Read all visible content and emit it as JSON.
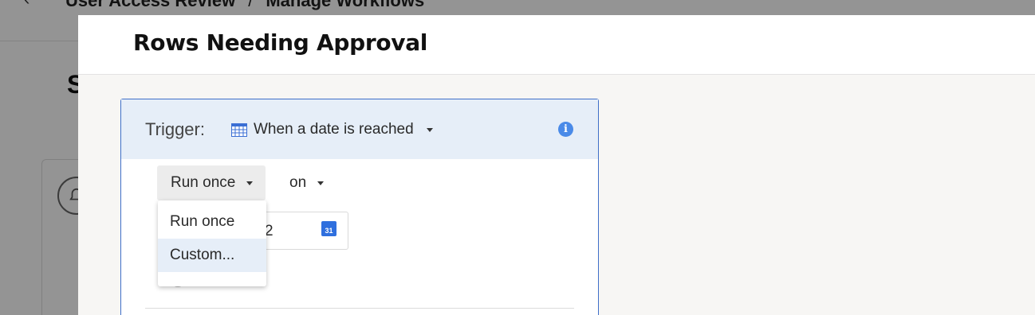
{
  "background": {
    "breadcrumb": [
      "User Access Review",
      "Manage Workflows"
    ],
    "breadcrumb_separator": "/",
    "side_title": "S"
  },
  "modal": {
    "title": "Rows Needing Approval"
  },
  "trigger": {
    "label": "Trigger:",
    "selected": "When a date is reached",
    "calendar_icon": "calendar-grid-icon",
    "info_icon": "info-icon",
    "info_glyph": "i"
  },
  "schedule": {
    "frequency_selected": "Run once",
    "on_label": "on",
    "date_partial": "2",
    "date_picker_icon": "google-calendar-icon",
    "date_picker_day": "31"
  },
  "frequency_menu": {
    "options": [
      "Run once",
      "Custom..."
    ],
    "highlighted": "Custom..."
  },
  "colors": {
    "accent": "#3f6fc8",
    "header_bg": "#e6eef8",
    "info": "#4a8ae8"
  }
}
